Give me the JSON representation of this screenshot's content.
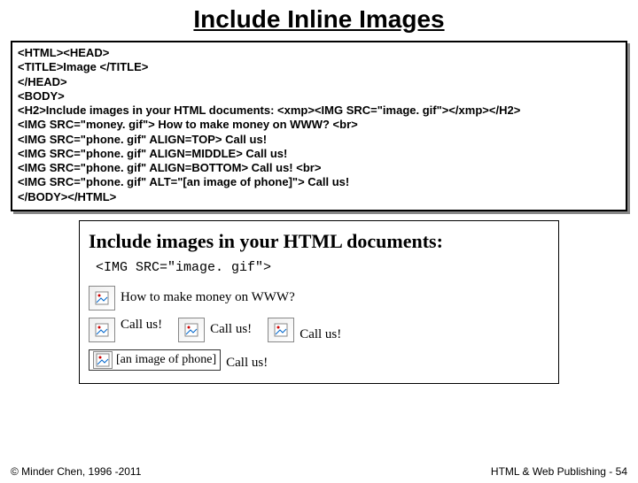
{
  "slide": {
    "title": "Include Inline Images",
    "copyright": "© Minder Chen, 1996 -2011",
    "footer_right": "HTML & Web Publishing - 54"
  },
  "code": {
    "l1": "<HTML><HEAD>",
    "l2": "<TITLE>Image </TITLE>",
    "l3": "</HEAD>",
    "l4": "<BODY>",
    "l5": "<H2>Include images in your HTML documents: <xmp><IMG SRC=\"image. gif\"></xmp></H2>",
    "l6": "<IMG SRC=\"money. gif\"> How to make money on WWW?  <br>",
    "l7": "<IMG SRC=\"phone. gif\" ALIGN=TOP> Call us!",
    "l8": "<IMG SRC=\"phone. gif\" ALIGN=MIDDLE> Call us!",
    "l9": "<IMG SRC=\"phone. gif\" ALIGN=BOTTOM> Call us!  <br>",
    "l10": "<IMG SRC=\"phone. gif\" ALT=\"[an image of phone]\"> Call us!",
    "l11": "</BODY></HTML>"
  },
  "render": {
    "heading": "Include images in your HTML documents:",
    "sub": "<IMG SRC=\"image. gif\">",
    "money": "How to make money on WWW?",
    "call": "Call us!",
    "alt": "[an image of phone]"
  }
}
